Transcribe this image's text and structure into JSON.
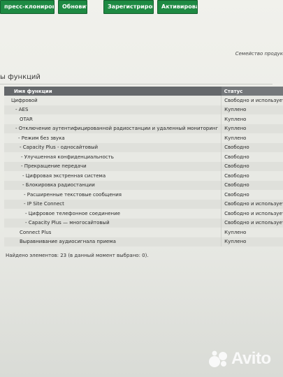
{
  "toolbar": {
    "express_clone_label": "пресс-клонирование",
    "refresh_label": "Обновить",
    "register_label": "Зарегистрировать",
    "activate_label": "Активировать"
  },
  "tagline": "Семейство продук",
  "section_title": "ы функций",
  "table": {
    "headers": {
      "name": "Имя функции",
      "status": "Статус"
    },
    "rows": [
      {
        "name": "Цифровой",
        "status": "Свободно и используется"
      },
      {
        "name": "- AES",
        "status": "Куплено"
      },
      {
        "name": "OTAR",
        "status": "Куплено"
      },
      {
        "name": "- Отключение аутентифицированной радиостанции и удаленный мониторинг",
        "status": "Куплено"
      },
      {
        "name": "- Режим без звука",
        "status": "Куплено"
      },
      {
        "name": "- Capacity Plus - односайтовый",
        "status": "Свободно"
      },
      {
        "name": "- Улучшенная конфиденциальность",
        "status": "Свободно"
      },
      {
        "name": "- Прекращение передачи",
        "status": "Свободно"
      },
      {
        "name": "- Цифровая экстренная система",
        "status": "Свободно"
      },
      {
        "name": "- Блокировка радиостанции",
        "status": "Свободно"
      },
      {
        "name": "- Расширенные текстовые сообщения",
        "status": "Свободно"
      },
      {
        "name": "- IP Site Connect",
        "status": "Свободно и используется"
      },
      {
        "name": "- Цифровое телефонное соединение",
        "status": "Свободно и используется"
      },
      {
        "name": "- Capacity Plus — многосайтовый",
        "status": "Свободно и используется"
      },
      {
        "name": "Connect Plus",
        "status": "Куплено"
      },
      {
        "name": "Выравнивание аудиосигнала приема",
        "status": "Куплено"
      }
    ]
  },
  "found_text": "Найдено элементов: 23 (в данный момент выбрано: 0).",
  "watermark": {
    "text": "Avito",
    "icon": "avito-logo-icon"
  },
  "colors": {
    "button_green": "#1e8a43",
    "header_gray": "#65686b"
  }
}
